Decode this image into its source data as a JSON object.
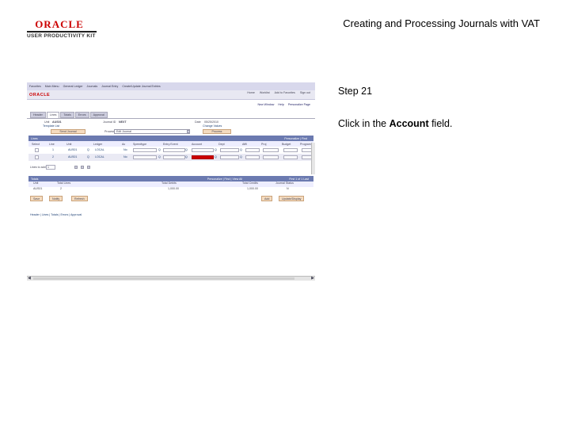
{
  "logo": {
    "brand": "ORACLE",
    "kit": "USER PRODUCTIVITY KIT"
  },
  "doc_title": "Creating and Processing Journals with VAT",
  "step": {
    "title": "Step 21",
    "instruction_prefix": "Click in the ",
    "instruction_bold": "Account",
    "instruction_suffix": " field."
  },
  "app": {
    "breadcrumbs": [
      "Favorites",
      "Main Menu",
      "General Ledger",
      "Journals",
      "Journal Entry",
      "Create/Update Journal Entries"
    ],
    "top_links": [
      "Home",
      "Worklist",
      "Add to Favorites",
      "Sign out"
    ],
    "oracle_logo": "ORACLE",
    "sub_links": [
      "New Window",
      "Help",
      "Personalize Page"
    ],
    "tabs": [
      "Header",
      "Lines",
      "Totals",
      "Errors",
      "Approval"
    ],
    "header": {
      "unit_label": "Unit",
      "unit_value": "AUS01",
      "journal_label": "Journal ID",
      "journal_value": "NEXT",
      "date_label": "Date",
      "date_value": "05/25/2010",
      "template_label": "Template List",
      "change_values": "Change Values",
      "process_label": "Process",
      "process_value": "Edit Journal",
      "send_button": "Send Journal",
      "process_button": "Process"
    },
    "lines": {
      "title": "Lines",
      "nav": "Personalize | Find",
      "columns": [
        "Select",
        "Line",
        "Unit",
        "Ledger",
        "Ac",
        "Speedtype",
        "Entry Event",
        "Account",
        "Dept",
        "Affil",
        "Proj",
        "Budget",
        "Program"
      ],
      "rows": [
        {
          "select": "",
          "line": "1",
          "unit": "AUS01",
          "ledger": "LOCAL",
          "ac": "No"
        },
        {
          "select": "",
          "line": "2",
          "unit": "AUS01",
          "ledger": "LOCAL",
          "ac": "No"
        }
      ],
      "lines_to_add_label": "Lines to add",
      "lines_to_add_value": "1"
    },
    "totals": {
      "title": "Totals",
      "nav": "Personalize | Find | View All",
      "pager": "First 1 of 1 Last",
      "columns": [
        "Unit",
        "Total Lines",
        "Total Debits",
        "Total Credits",
        "Journal Status"
      ],
      "row": [
        "AUS01",
        "2",
        "1,000.00",
        "1,000.00",
        "N"
      ]
    },
    "buttons": [
      "Save",
      "Notify",
      "Refresh",
      "Add",
      "Update/Display"
    ],
    "footer_links": "Header | Lines | Totals | Errors | Approval"
  }
}
